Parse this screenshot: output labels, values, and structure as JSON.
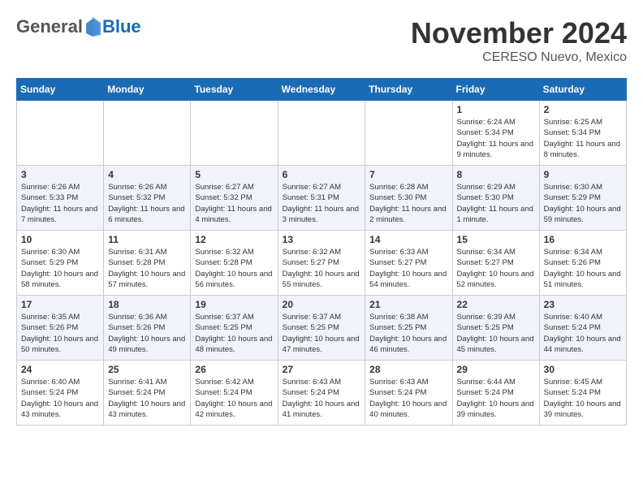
{
  "logo": {
    "general": "General",
    "blue": "Blue"
  },
  "title": "November 2024",
  "location": "CERESO Nuevo, Mexico",
  "headers": [
    "Sunday",
    "Monday",
    "Tuesday",
    "Wednesday",
    "Thursday",
    "Friday",
    "Saturday"
  ],
  "weeks": [
    [
      {
        "day": "",
        "detail": ""
      },
      {
        "day": "",
        "detail": ""
      },
      {
        "day": "",
        "detail": ""
      },
      {
        "day": "",
        "detail": ""
      },
      {
        "day": "",
        "detail": ""
      },
      {
        "day": "1",
        "detail": "Sunrise: 6:24 AM\nSunset: 5:34 PM\nDaylight: 11 hours and 9 minutes."
      },
      {
        "day": "2",
        "detail": "Sunrise: 6:25 AM\nSunset: 5:34 PM\nDaylight: 11 hours and 8 minutes."
      }
    ],
    [
      {
        "day": "3",
        "detail": "Sunrise: 6:26 AM\nSunset: 5:33 PM\nDaylight: 11 hours and 7 minutes."
      },
      {
        "day": "4",
        "detail": "Sunrise: 6:26 AM\nSunset: 5:32 PM\nDaylight: 11 hours and 6 minutes."
      },
      {
        "day": "5",
        "detail": "Sunrise: 6:27 AM\nSunset: 5:32 PM\nDaylight: 11 hours and 4 minutes."
      },
      {
        "day": "6",
        "detail": "Sunrise: 6:27 AM\nSunset: 5:31 PM\nDaylight: 11 hours and 3 minutes."
      },
      {
        "day": "7",
        "detail": "Sunrise: 6:28 AM\nSunset: 5:30 PM\nDaylight: 11 hours and 2 minutes."
      },
      {
        "day": "8",
        "detail": "Sunrise: 6:29 AM\nSunset: 5:30 PM\nDaylight: 11 hours and 1 minute."
      },
      {
        "day": "9",
        "detail": "Sunrise: 6:30 AM\nSunset: 5:29 PM\nDaylight: 10 hours and 59 minutes."
      }
    ],
    [
      {
        "day": "10",
        "detail": "Sunrise: 6:30 AM\nSunset: 5:29 PM\nDaylight: 10 hours and 58 minutes."
      },
      {
        "day": "11",
        "detail": "Sunrise: 6:31 AM\nSunset: 5:28 PM\nDaylight: 10 hours and 57 minutes."
      },
      {
        "day": "12",
        "detail": "Sunrise: 6:32 AM\nSunset: 5:28 PM\nDaylight: 10 hours and 56 minutes."
      },
      {
        "day": "13",
        "detail": "Sunrise: 6:32 AM\nSunset: 5:27 PM\nDaylight: 10 hours and 55 minutes."
      },
      {
        "day": "14",
        "detail": "Sunrise: 6:33 AM\nSunset: 5:27 PM\nDaylight: 10 hours and 54 minutes."
      },
      {
        "day": "15",
        "detail": "Sunrise: 6:34 AM\nSunset: 5:27 PM\nDaylight: 10 hours and 52 minutes."
      },
      {
        "day": "16",
        "detail": "Sunrise: 6:34 AM\nSunset: 5:26 PM\nDaylight: 10 hours and 51 minutes."
      }
    ],
    [
      {
        "day": "17",
        "detail": "Sunrise: 6:35 AM\nSunset: 5:26 PM\nDaylight: 10 hours and 50 minutes."
      },
      {
        "day": "18",
        "detail": "Sunrise: 6:36 AM\nSunset: 5:26 PM\nDaylight: 10 hours and 49 minutes."
      },
      {
        "day": "19",
        "detail": "Sunrise: 6:37 AM\nSunset: 5:25 PM\nDaylight: 10 hours and 48 minutes."
      },
      {
        "day": "20",
        "detail": "Sunrise: 6:37 AM\nSunset: 5:25 PM\nDaylight: 10 hours and 47 minutes."
      },
      {
        "day": "21",
        "detail": "Sunrise: 6:38 AM\nSunset: 5:25 PM\nDaylight: 10 hours and 46 minutes."
      },
      {
        "day": "22",
        "detail": "Sunrise: 6:39 AM\nSunset: 5:25 PM\nDaylight: 10 hours and 45 minutes."
      },
      {
        "day": "23",
        "detail": "Sunrise: 6:40 AM\nSunset: 5:24 PM\nDaylight: 10 hours and 44 minutes."
      }
    ],
    [
      {
        "day": "24",
        "detail": "Sunrise: 6:40 AM\nSunset: 5:24 PM\nDaylight: 10 hours and 43 minutes."
      },
      {
        "day": "25",
        "detail": "Sunrise: 6:41 AM\nSunset: 5:24 PM\nDaylight: 10 hours and 43 minutes."
      },
      {
        "day": "26",
        "detail": "Sunrise: 6:42 AM\nSunset: 5:24 PM\nDaylight: 10 hours and 42 minutes."
      },
      {
        "day": "27",
        "detail": "Sunrise: 6:43 AM\nSunset: 5:24 PM\nDaylight: 10 hours and 41 minutes."
      },
      {
        "day": "28",
        "detail": "Sunrise: 6:43 AM\nSunset: 5:24 PM\nDaylight: 10 hours and 40 minutes."
      },
      {
        "day": "29",
        "detail": "Sunrise: 6:44 AM\nSunset: 5:24 PM\nDaylight: 10 hours and 39 minutes."
      },
      {
        "day": "30",
        "detail": "Sunrise: 6:45 AM\nSunset: 5:24 PM\nDaylight: 10 hours and 39 minutes."
      }
    ]
  ]
}
